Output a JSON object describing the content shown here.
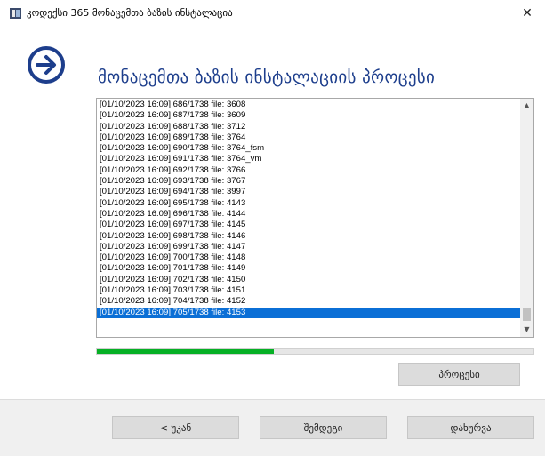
{
  "window": {
    "title": "კოდექსი 365 მონაცემთა ბაზის ინსტალაცია",
    "close_glyph": "✕"
  },
  "header": {
    "icon": "arrow-right-circle-icon",
    "title": "მონაცემთა ბაზის ინსტალაციის პროცესი",
    "accent_color": "#1d3e8c"
  },
  "log": {
    "lines": [
      "[01/10/2023 16:09]  686/1738 file: 3608",
      "[01/10/2023 16:09]  687/1738 file: 3609",
      "[01/10/2023 16:09]  688/1738 file: 3712",
      "[01/10/2023 16:09]  689/1738 file: 3764",
      "[01/10/2023 16:09]  690/1738 file: 3764_fsm",
      "[01/10/2023 16:09]  691/1738 file: 3764_vm",
      "[01/10/2023 16:09]  692/1738 file: 3766",
      "[01/10/2023 16:09]  693/1738 file: 3767",
      "[01/10/2023 16:09]  694/1738 file: 3997",
      "[01/10/2023 16:09]  695/1738 file: 4143",
      "[01/10/2023 16:09]  696/1738 file: 4144",
      "[01/10/2023 16:09]  697/1738 file: 4145",
      "[01/10/2023 16:09]  698/1738 file: 4146",
      "[01/10/2023 16:09]  699/1738 file: 4147",
      "[01/10/2023 16:09]  700/1738 file: 4148",
      "[01/10/2023 16:09]  701/1738 file: 4149",
      "[01/10/2023 16:09]  702/1738 file: 4150",
      "[01/10/2023 16:09]  703/1738 file: 4151",
      "[01/10/2023 16:09]  704/1738 file: 4152",
      "[01/10/2023 16:09]  705/1738 file: 4153"
    ],
    "selected_index": 19,
    "selection_color": "#0b6fd6"
  },
  "progress": {
    "fraction": 0.405,
    "color": "#06b025"
  },
  "buttons": {
    "process": "პროცესი",
    "back": "< უკან",
    "next": "შემდეგი",
    "close": "დახურვა"
  }
}
